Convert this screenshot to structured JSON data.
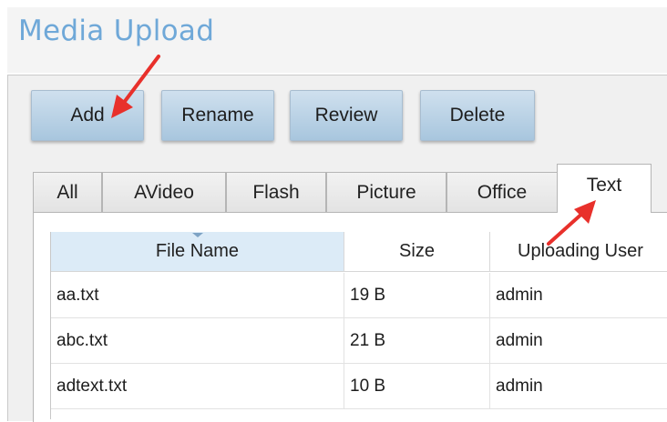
{
  "page": {
    "title": "Media Upload"
  },
  "toolbar": {
    "add_label": "Add",
    "rename_label": "Rename",
    "review_label": "Review",
    "delete_label": "Delete"
  },
  "tabs": [
    {
      "label": "All"
    },
    {
      "label": "AVideo"
    },
    {
      "label": "Flash"
    },
    {
      "label": "Picture"
    },
    {
      "label": "Office"
    },
    {
      "label": "Text",
      "active": true
    }
  ],
  "table": {
    "columns": [
      "File Name",
      "Size",
      "Uploading User"
    ],
    "rows": [
      [
        "aa.txt",
        "19 B",
        "admin"
      ],
      [
        "abc.txt",
        "21 B",
        "admin"
      ],
      [
        "adtext.txt",
        "10 B",
        "admin"
      ]
    ]
  },
  "colors": {
    "title": "#6fa8d8",
    "button": "#b6d0e4",
    "arrow": "#e8302b",
    "sorted_header": "#dcebf7"
  }
}
